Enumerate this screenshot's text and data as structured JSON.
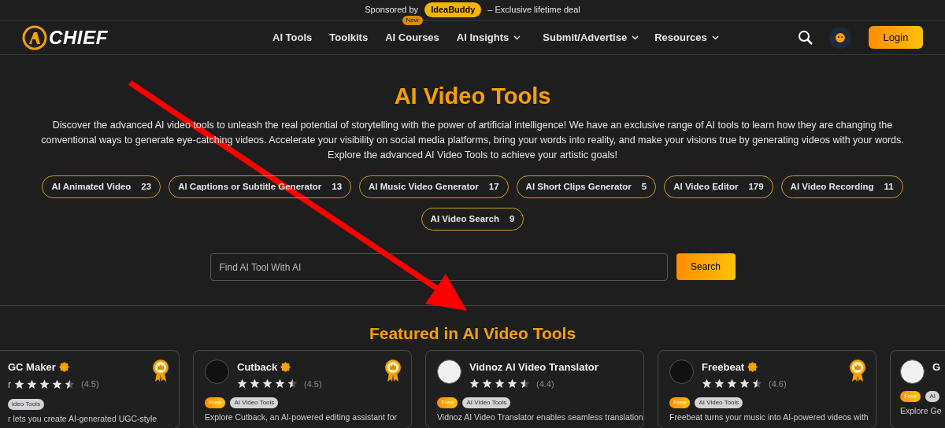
{
  "sponsor_bar": {
    "prefix": "Sponsored by",
    "sponsor": "IdeaBuddy",
    "suffix": "– Exclusive lifetime deal"
  },
  "nav": {
    "logo": "CHIEF",
    "items": [
      {
        "label": "AI Tools",
        "dropdown": false
      },
      {
        "label": "Toolkits",
        "dropdown": false
      },
      {
        "label": "AI Courses",
        "badge": "New",
        "dropdown": false
      },
      {
        "label": "AI Insights",
        "dropdown": true
      },
      {
        "label": "Submit/Advertise",
        "dropdown": true
      },
      {
        "label": "Resources",
        "dropdown": true
      }
    ],
    "login": "Login"
  },
  "hero": {
    "title": "AI Video Tools",
    "description": "Discover the advanced AI video tools to unleash the real potential of storytelling with the power of artificial intelligence! We have an exclusive range of AI tools to learn how they are changing the conventional ways to generate eye-catching videos. Accelerate your visibility on social media platforms, bring your words into reality, and make your visions true by generating videos with your words. Explore the advanced AI Video Tools to achieve your artistic goals!"
  },
  "categories": [
    {
      "label": "AI Animated Video",
      "count": "23"
    },
    {
      "label": "AI Captions or Subtitle Generator",
      "count": "13"
    },
    {
      "label": "AI Music Video Generator",
      "count": "17"
    },
    {
      "label": "AI Short Clips Generator",
      "count": "5"
    },
    {
      "label": "AI Video Editor",
      "count": "179"
    },
    {
      "label": "AI Video Recording",
      "count": "11"
    },
    {
      "label": "AI Video Search",
      "count": "9"
    }
  ],
  "search": {
    "placeholder": "Find AI Tool With AI",
    "button": "Search"
  },
  "featured": {
    "title": "Featured in AI Video Tools",
    "cards": [
      {
        "kind": "partial-left",
        "name": "GC Maker",
        "verified": true,
        "award": true,
        "rating_prefix": "r",
        "stars": 4.5,
        "rating": "(4.5)",
        "tags": [
          {
            "label": "ideo Tools",
            "kind": "category"
          }
        ],
        "description": "r lets you create AI-generated UGC-style"
      },
      {
        "kind": "full",
        "name": "Cutback",
        "verified": true,
        "award": true,
        "stars": 4.5,
        "rating": "(4.5)",
        "tags": [
          {
            "label": "Free",
            "kind": "price"
          },
          {
            "label": "AI Video Tools",
            "kind": "category"
          }
        ],
        "description": "Explore Cutback, an AI-powered editing assistant for"
      },
      {
        "kind": "full",
        "name": "Vidnoz AI Video Translator",
        "verified": false,
        "award": false,
        "stars": 4.5,
        "rating": "(4.4)",
        "tags": [
          {
            "label": "Free",
            "kind": "price"
          },
          {
            "label": "AI Video Tools",
            "kind": "category"
          }
        ],
        "description": "Vidnoz AI Video Translator enables seamless translation"
      },
      {
        "kind": "full",
        "name": "Freebeat",
        "verified": true,
        "award": true,
        "stars": 4.5,
        "rating": "(4.6)",
        "tags": [
          {
            "label": "Free",
            "kind": "price"
          },
          {
            "label": "AI Video Tools",
            "kind": "category"
          }
        ],
        "description": "Freebeat turns your music into AI-powered videos with"
      },
      {
        "kind": "partial-right",
        "name": "G",
        "verified": false,
        "award": false,
        "tags": [
          {
            "label": "Free",
            "kind": "price"
          },
          {
            "label": "AI",
            "kind": "category"
          }
        ],
        "description": "Explore Ge"
      }
    ]
  }
}
